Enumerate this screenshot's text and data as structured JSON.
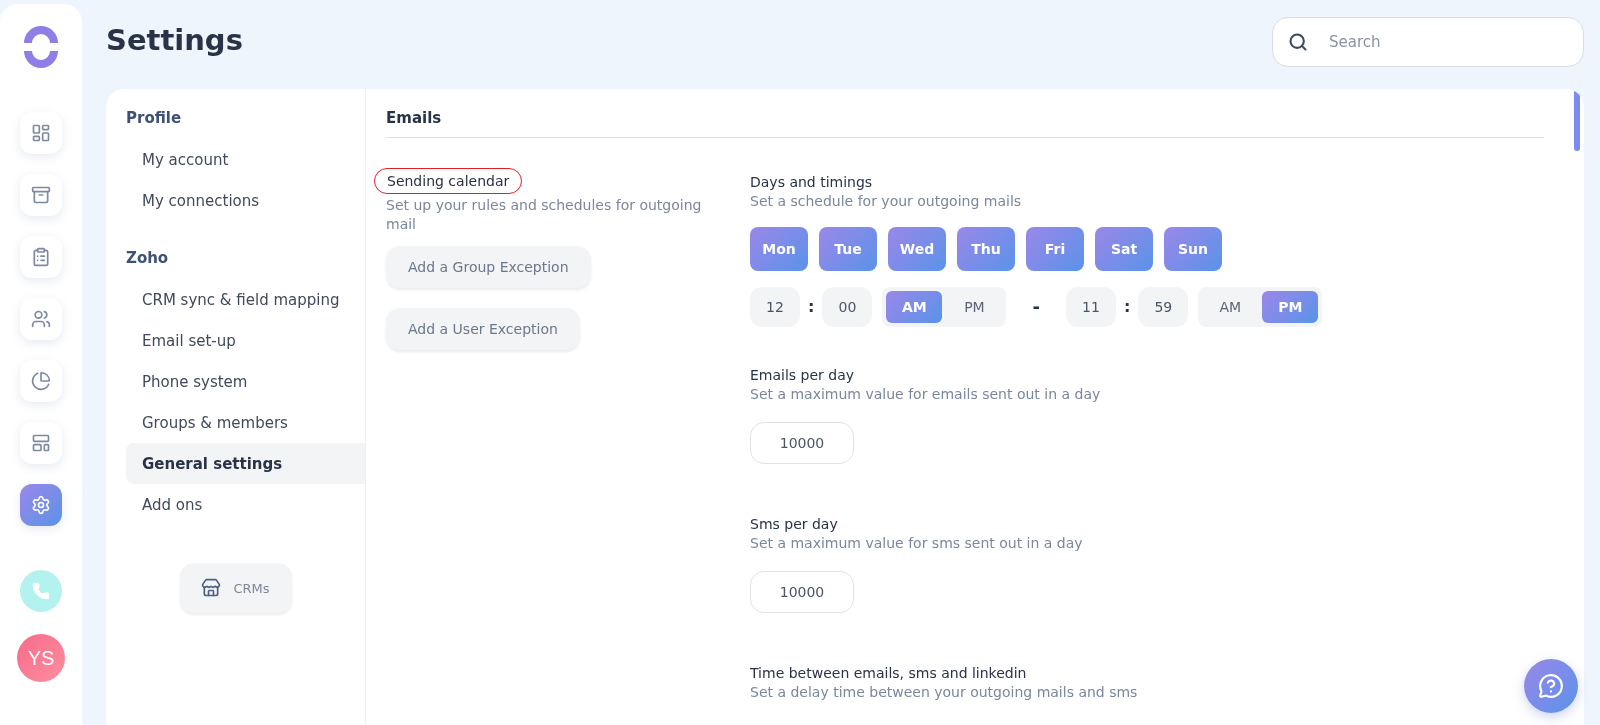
{
  "rail": {
    "items": [
      {
        "selected": false
      },
      {
        "selected": false
      },
      {
        "selected": false
      },
      {
        "selected": false
      },
      {
        "selected": false
      },
      {
        "selected": false
      },
      {
        "selected": true
      }
    ],
    "avatar": "YS"
  },
  "page": {
    "title": "Settings"
  },
  "search": {
    "placeholder": "Search"
  },
  "nav": {
    "sections": [
      {
        "title": "Profile",
        "items": [
          {
            "label": "My account",
            "selected": false
          },
          {
            "label": "My connections",
            "selected": false
          }
        ]
      },
      {
        "title": "Zoho",
        "items": [
          {
            "label": "CRM sync & field mapping",
            "selected": false
          },
          {
            "label": "Email set-up",
            "selected": false
          },
          {
            "label": "Phone system",
            "selected": false
          },
          {
            "label": "Groups & members",
            "selected": false
          },
          {
            "label": "General settings",
            "selected": true
          },
          {
            "label": "Add ons",
            "selected": false
          }
        ]
      }
    ],
    "crm_button": "CRMs"
  },
  "content": {
    "heading": "Emails",
    "calendar": {
      "title": "Sending calendar",
      "description": "Set up your rules and schedules for outgoing mail",
      "buttons": [
        "Add a Group Exception",
        "Add a User Exception"
      ]
    },
    "days": {
      "title": "Days and timings",
      "description": "Set a schedule for your outgoing mails",
      "items": [
        {
          "label": "Mon",
          "selected": true
        },
        {
          "label": "Tue",
          "selected": true
        },
        {
          "label": "Wed",
          "selected": true
        },
        {
          "label": "Thu",
          "selected": true
        },
        {
          "label": "Fri",
          "selected": true
        },
        {
          "label": "Sat",
          "selected": true
        },
        {
          "label": "Sun",
          "selected": true
        }
      ],
      "separator": "-",
      "times": [
        {
          "hour": "12",
          "colon": ":",
          "minute": "00",
          "periods": [
            {
              "label": "AM",
              "selected": true
            },
            {
              "label": "PM",
              "selected": false
            }
          ]
        },
        {
          "hour": "11",
          "colon": ":",
          "minute": "59",
          "periods": [
            {
              "label": "AM",
              "selected": false
            },
            {
              "label": "PM",
              "selected": true
            }
          ]
        }
      ]
    },
    "limits": [
      {
        "title": "Emails per day",
        "description": "Set a maximum value for emails sent out in a day",
        "value": "10000"
      },
      {
        "title": "Sms per day",
        "description": "Set a maximum value for sms sent out in a day",
        "value": "10000"
      }
    ],
    "delay": {
      "title": "Time between emails, sms and linkedin",
      "description": "Set a delay time between your outgoing mails and sms"
    }
  }
}
